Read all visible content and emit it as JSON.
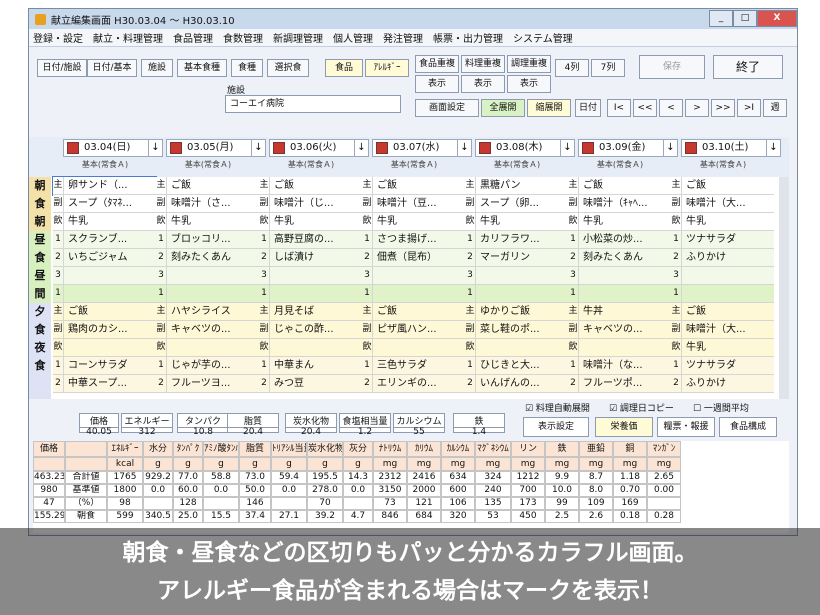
{
  "window": {
    "title": "献立編集画面 H30.03.04 ～ H30.03.10",
    "minimize": "_",
    "maximize": "□",
    "close": "X"
  },
  "menu": [
    "登録・設定",
    "献立・料理管理",
    "食品管理",
    "食数管理",
    "新調理管理",
    "個人管理",
    "発注管理",
    "帳票・出力管理",
    "システム管理"
  ],
  "toolbar": {
    "tabs": [
      "日付/施設",
      "日付/基本",
      "施設",
      "基本食種",
      "食種",
      "選択食"
    ],
    "food": "食品",
    "allergy": "ｱﾚﾙｷﾞｰ",
    "dup": [
      "食品重複",
      "料理重複",
      "調理重複"
    ],
    "show": [
      "表示",
      "表示",
      "表示"
    ],
    "cols": [
      "4列",
      "7列"
    ],
    "save": "保存",
    "exit": "終了",
    "facility_label": "施設",
    "facility": "コーエイ病院",
    "screen_settings": "画面設定",
    "expand": "全展開",
    "collapse": "縮展開",
    "date": "日付",
    "nav": [
      "I<",
      "<<",
      "<",
      ">",
      ">>",
      ">I",
      "週"
    ]
  },
  "days": [
    "03.04(日)",
    "03.05(月)",
    "03.06(火)",
    "03.07(水)",
    "03.08(木)",
    "03.09(金)",
    "03.10(土)"
  ],
  "kihon": "基本(常食Ａ)",
  "meals": {
    "breakfast": [
      "朝",
      "食",
      "朝",
      "間"
    ],
    "lunch": [
      "昼",
      "食",
      "昼",
      "間"
    ],
    "dinner": [
      "夕",
      "食",
      "夜",
      "食"
    ]
  },
  "rows": [
    {
      "k": [
        "主",
        "副",
        "飲",
        "1",
        "2",
        "3"
      ],
      "c": [
        [
          "卵サンド（...",
          "スープ（ﾀﾏﾈ...",
          "牛乳",
          "スクランブ...",
          "いちごジャム",
          ""
        ],
        [
          "ご飯",
          "味噌汁（さ...",
          "牛乳",
          "ブロッコリ...",
          "刻みたくあん",
          ""
        ],
        [
          "ご飯",
          "味噌汁（じ...",
          "牛乳",
          "高野豆腐の...",
          "しば漬け",
          ""
        ],
        [
          "ご飯",
          "味噌汁（豆...",
          "牛乳",
          "さつま揚げ...",
          "佃煮（昆布）",
          ""
        ],
        [
          "黒糖パン",
          "スープ（卵...",
          "牛乳",
          "カリフラワ...",
          "マーガリン",
          ""
        ],
        [
          "ご飯",
          "味噌汁（ｷｬﾍ...",
          "牛乳",
          "小松菜の炒...",
          "刻みたくあん",
          ""
        ],
        [
          "ご飯",
          "味噌汁（大...",
          "牛乳",
          "ツナサラダ",
          "ふりかけ",
          ""
        ]
      ]
    }
  ],
  "extra": {
    "k": [
      "1",
      "主",
      "副",
      "飲",
      "1",
      "2"
    ],
    "c": [
      [
        "",
        "ご飯",
        "鶏肉のカシ...",
        "",
        "コーンサラダ",
        "中華スープ..."
      ],
      [
        "",
        "ハヤシライス",
        "キャベツの...",
        "",
        "じゃが芋の...",
        "フルーツヨ..."
      ],
      [
        "",
        "月見そば",
        "じゃこの酢...",
        "",
        "中華まん",
        "みつ豆"
      ],
      [
        "",
        "ご飯",
        "ピザ風ハン...",
        "",
        "三色サラダ",
        "エリンギの..."
      ],
      [
        "",
        "ゆかりご飯",
        "菜し鞋のポ...",
        "",
        "ひじきと大...",
        "いんげんの..."
      ],
      [
        "",
        "牛丼",
        "キャベツの...",
        "",
        "味噌汁（な...",
        "フルーツポ..."
      ],
      [
        "",
        "ご飯",
        "味噌汁（大...",
        "牛乳",
        "ツナサラダ",
        "ふりかけ"
      ]
    ]
  },
  "nutrition": {
    "labels": [
      "価格",
      "エネルギー",
      "タンパク",
      "脂質",
      "炭水化物",
      "食塩相当量",
      "カルシウム",
      "鉄"
    ],
    "values": [
      "40.05",
      "312",
      "10.8",
      "20.4",
      "20.4",
      "1.2",
      "55",
      "1.4"
    ],
    "checks": [
      "料理自動展開",
      "調理日コピー",
      "一週間平均"
    ],
    "display": "表示設定",
    "buttons": [
      "栄養価",
      "糧票・報援",
      "食品構成"
    ]
  },
  "table": {
    "head": [
      "価格",
      "",
      "ｴﾈﾙｷﾞｰ",
      "水分",
      "ﾀﾝﾊﾟｸ",
      "ｱﾐﾉ酸ﾀﾝﾊﾟｸ",
      "脂質",
      "ﾄﾘｱｼﾙ当量",
      "炭水化物",
      "灰分",
      "ﾅﾄﾘｳﾑ",
      "ｶﾘｳﾑ",
      "ｶﾙｼｳﾑ",
      "ﾏｸﾞﾈｼｳﾑ",
      "リン",
      "鉄",
      "亜鉛",
      "銅",
      "ﾏﾝｶﾞﾝ"
    ],
    "units": [
      "",
      "",
      "kcal",
      "g",
      "g",
      "g",
      "g",
      "g",
      "g",
      "g",
      "mg",
      "mg",
      "mg",
      "mg",
      "mg",
      "mg",
      "mg",
      "mg",
      "mg"
    ],
    "rows": [
      [
        "463.23",
        "合計値",
        "1765",
        "929.2",
        "77.0",
        "58.8",
        "73.0",
        "59.4",
        "195.5",
        "14.3",
        "2312",
        "2416",
        "634",
        "324",
        "1212",
        "9.9",
        "8.7",
        "1.18",
        "2.65"
      ],
      [
        "980",
        "基準値",
        "1800",
        "0.0",
        "60.0",
        "0.0",
        "50.0",
        "0.0",
        "278.0",
        "0.0",
        "3150",
        "2000",
        "600",
        "240",
        "700",
        "10.0",
        "8.0",
        "0.70",
        "0.00"
      ],
      [
        "47",
        "（%）",
        "98",
        "",
        "128",
        "",
        "146",
        "",
        "70",
        "",
        "73",
        "121",
        "106",
        "135",
        "173",
        "99",
        "109",
        "169",
        ""
      ],
      [
        "155.29",
        "朝食",
        "599",
        "340.5",
        "25.0",
        "15.5",
        "37.4",
        "27.1",
        "39.2",
        "4.7",
        "846",
        "684",
        "320",
        "53",
        "450",
        "2.5",
        "2.6",
        "0.18",
        "0.28"
      ]
    ]
  },
  "caption": [
    "朝食・昼食などの区切りもパッと分かるカラフル画面。",
    "アレルギー食品が含まれる場合はマークを表示！"
  ]
}
